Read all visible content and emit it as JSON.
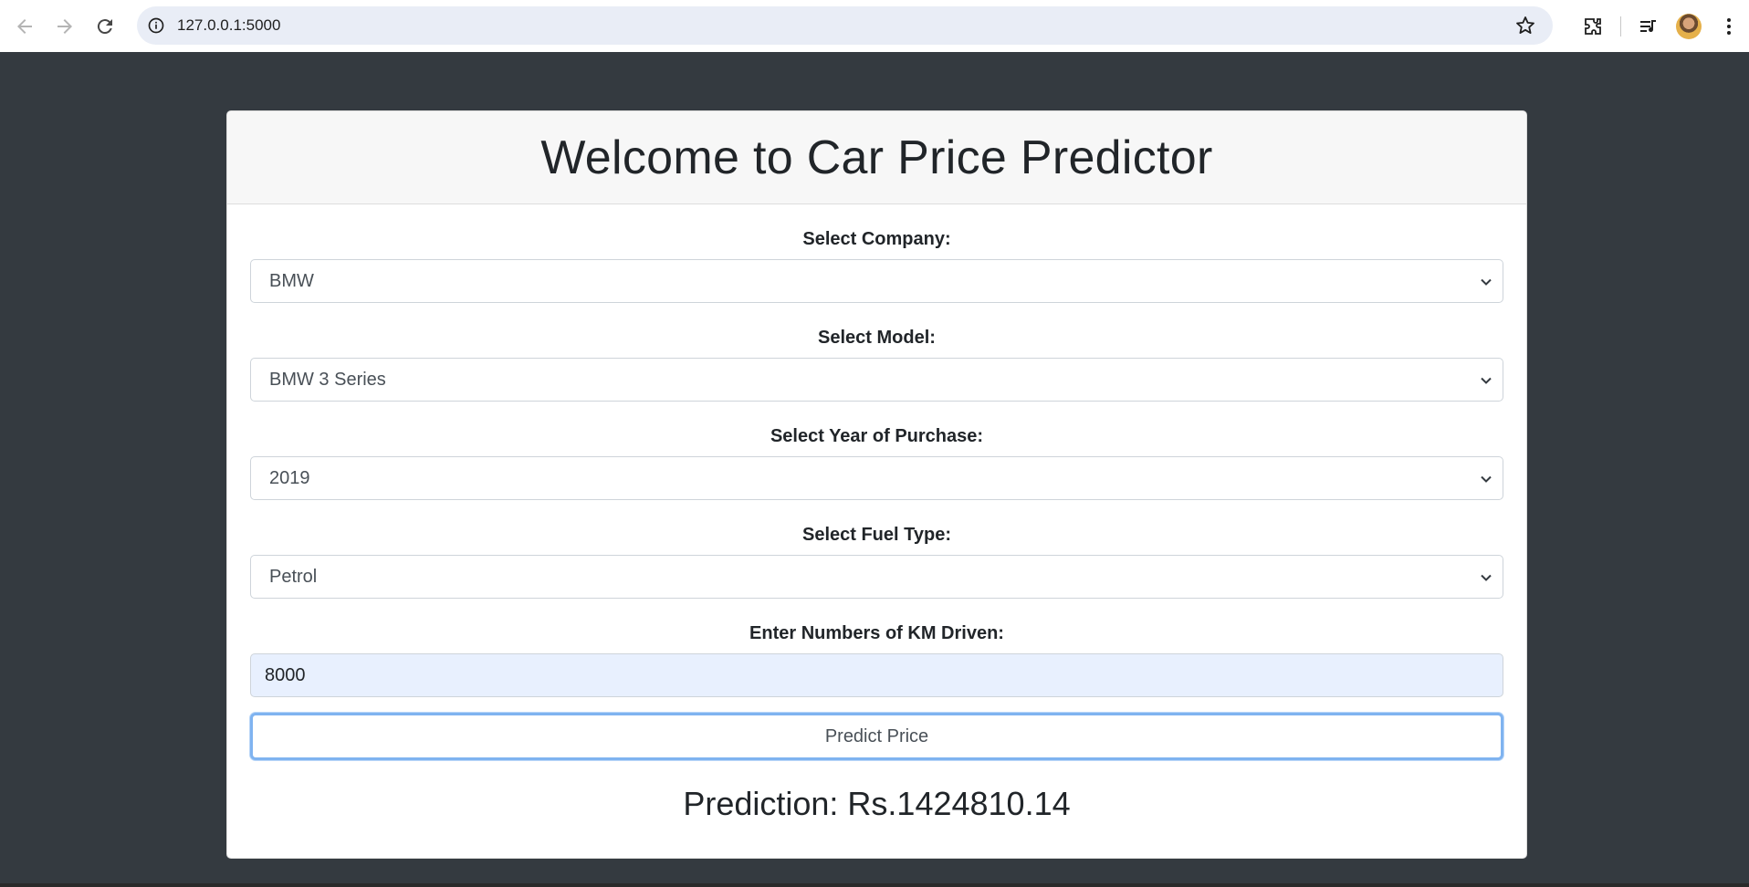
{
  "browser": {
    "url": "127.0.0.1:5000",
    "icons": [
      "back-arrow-icon",
      "forward-arrow-icon",
      "reload-icon",
      "site-info-icon",
      "bookmark-star-icon",
      "extensions-icon",
      "reading-list-icon",
      "profile-avatar",
      "more-menu-icon"
    ]
  },
  "page": {
    "title": "Welcome to Car Price Predictor",
    "company": {
      "label": "Select Company:",
      "value": "BMW"
    },
    "model": {
      "label": "Select Model:",
      "value": "BMW 3 Series"
    },
    "year": {
      "label": "Select Year of Purchase:",
      "value": "2019"
    },
    "fuel": {
      "label": "Select Fuel Type:",
      "value": "Petrol"
    },
    "km": {
      "label": "Enter Numbers of KM Driven:",
      "value": "8000"
    },
    "submit_label": "Predict Price",
    "prediction": "Prediction: Rs.1424810.14"
  },
  "colors": {
    "page_background": "#343a40",
    "card_header": "#f7f7f7",
    "focus_ring": "#7fb3f0",
    "autofill_input": "#e8f0fe"
  }
}
